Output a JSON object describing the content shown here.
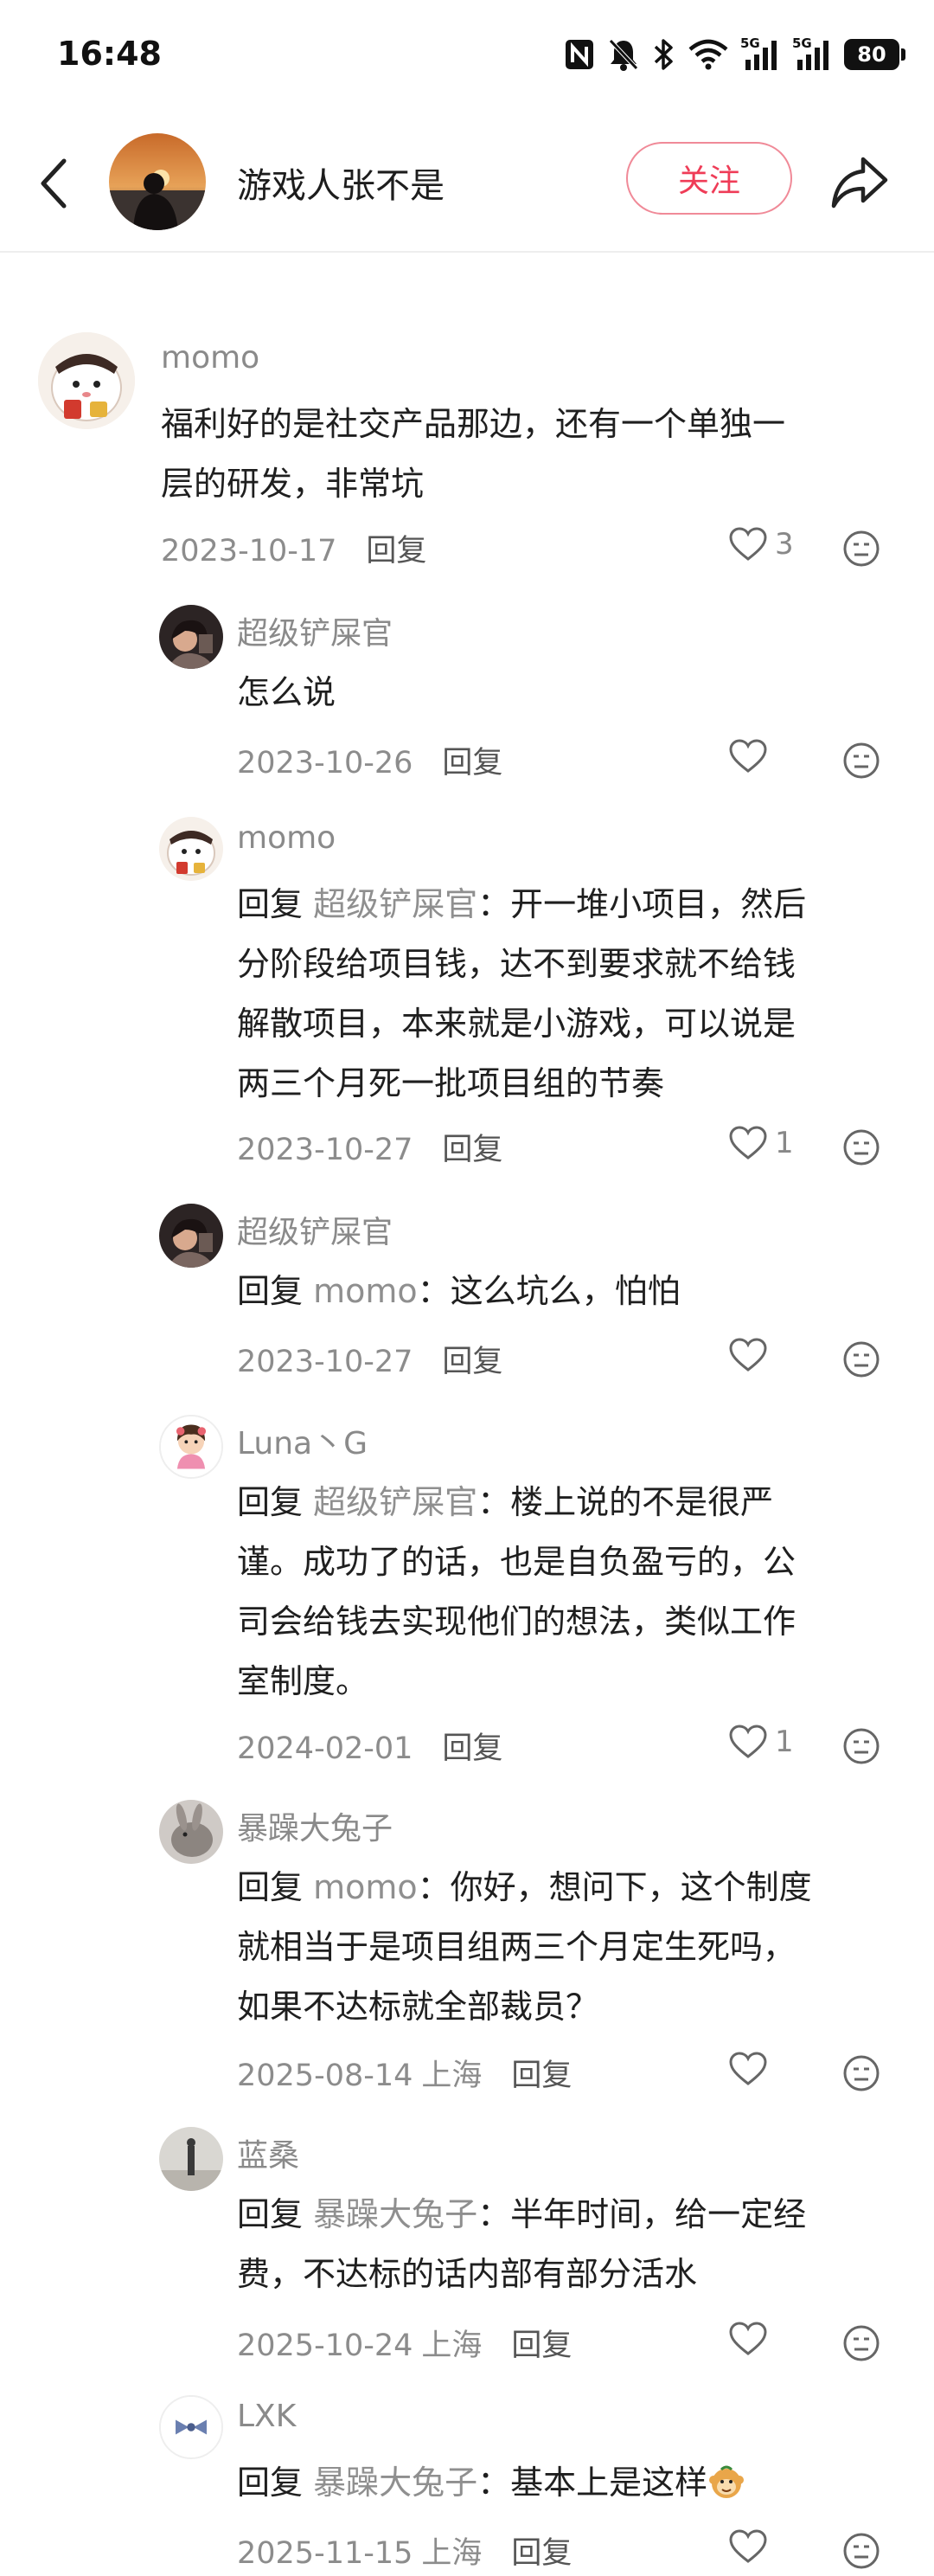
{
  "status_bar": {
    "time": "16:48",
    "battery": "80",
    "signal_label_1": "5G",
    "signal_label_2": "5G",
    "icons": [
      "nfc-icon",
      "mute-bell-icon",
      "bluetooth-icon",
      "wifi-icon",
      "signal-5g-icon",
      "signal-5g-icon",
      "battery-icon"
    ]
  },
  "header": {
    "username": "游戏人张不是",
    "follow_label": "关注",
    "accent_color": "#ef3c57"
  },
  "labels": {
    "reply_prefix": "回复",
    "reply_button": "回复"
  },
  "comments": [
    {
      "user": "momo",
      "text": "福利好的是社交产品那边，还有一个单独一层的研发，非常坑",
      "text_lines": [
        "福利好的是社交产品那边，还有一个单独一",
        "层的研发，非常坑"
      ],
      "date": "2023-10-17",
      "likes": "3"
    },
    {
      "user": "超级铲屎官",
      "text_lines": [
        "怎么说"
      ],
      "date": "2023-10-26",
      "likes": ""
    },
    {
      "user": "momo",
      "reply_to": "超级铲屎官",
      "text_lines": [
        "：开一堆小项目，然后",
        "分阶段给项目钱，达不到要求就不给钱",
        "解散项目，本来就是小游戏，可以说是",
        "两三个月死一批项目组的节奏"
      ],
      "date": "2023-10-27",
      "likes": "1"
    },
    {
      "user": "超级铲屎官",
      "reply_to": "momo",
      "text_lines": [
        "：这么坑么，怕怕"
      ],
      "date": "2023-10-27",
      "likes": ""
    },
    {
      "user": "Luna丶G",
      "reply_to": "超级铲屎官",
      "text_lines": [
        "：楼上说的不是很严",
        "谨。成功了的话，也是自负盈亏的，公",
        "司会给钱去实现他们的想法，类似工作",
        "室制度。"
      ],
      "date": "2024-02-01",
      "likes": "1"
    },
    {
      "user": "暴躁大兔子",
      "reply_to": "momo",
      "text_lines": [
        "：你好，想问下，这个制度",
        "就相当于是项目组两三个月定生死吗，",
        "如果不达标就全部裁员？"
      ],
      "date": "2025-08-14",
      "location": "上海",
      "likes": ""
    },
    {
      "user": "蓝桑",
      "reply_to": "暴躁大兔子",
      "text_lines": [
        "：半年时间，给一定经",
        "费，不达标的话内部有部分活水"
      ],
      "date": "2025-10-24",
      "location": "上海",
      "likes": ""
    },
    {
      "user": "LXK",
      "reply_to": "暴躁大兔子",
      "text_lines": [
        "：基本上是这样"
      ],
      "date": "2025-11-15",
      "location": "上海",
      "likes": "",
      "trailing_emoji": "monkey-emoji-icon"
    }
  ]
}
